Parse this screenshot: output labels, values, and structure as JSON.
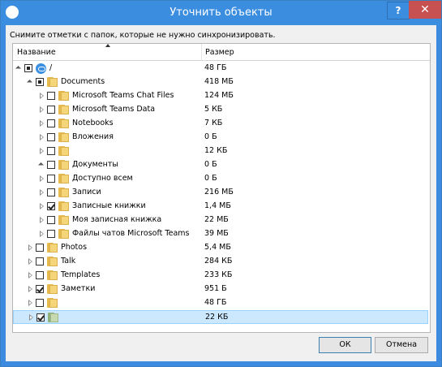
{
  "window": {
    "title": "Уточнить объекты",
    "help_label": "?",
    "close_label": "✕"
  },
  "instruction": "Снимите отметки с папок, которые не нужно синхронизировать.",
  "columns": {
    "name": "Название",
    "size": "Размер"
  },
  "rows": [
    {
      "name": "/",
      "size": "48 ГБ",
      "level": 0,
      "expander": "open",
      "check": "partial",
      "icon": "sync-icon"
    },
    {
      "name": "Documents",
      "size": "418 МБ",
      "level": 1,
      "expander": "open",
      "check": "partial",
      "icon": "folder-icon"
    },
    {
      "name": "Microsoft Teams Chat Files",
      "size": "124 МБ",
      "level": 2,
      "expander": "closed",
      "check": "unchecked",
      "icon": "folder-icon"
    },
    {
      "name": "Microsoft Teams Data",
      "size": "5 КБ",
      "level": 2,
      "expander": "closed",
      "check": "unchecked",
      "icon": "folder-icon"
    },
    {
      "name": "Notebooks",
      "size": "7 КБ",
      "level": 2,
      "expander": "closed",
      "check": "unchecked",
      "icon": "folder-icon"
    },
    {
      "name": "Вложения",
      "size": "0 Б",
      "level": 2,
      "expander": "closed",
      "check": "unchecked",
      "icon": "folder-icon"
    },
    {
      "name": "",
      "size": "12 КБ",
      "level": 2,
      "expander": "closed",
      "check": "unchecked",
      "icon": "folder-icon"
    },
    {
      "name": "Документы",
      "size": "0 Б",
      "level": 2,
      "expander": "open",
      "check": "unchecked",
      "icon": "folder-icon"
    },
    {
      "name": "Доступно всем",
      "size": "0 Б",
      "level": 2,
      "expander": "closed",
      "check": "unchecked",
      "icon": "folder-icon"
    },
    {
      "name": "Записи",
      "size": "216 МБ",
      "level": 2,
      "expander": "closed",
      "check": "unchecked",
      "icon": "folder-icon"
    },
    {
      "name": "Записные книжки",
      "size": "1,4 МБ",
      "level": 2,
      "expander": "closed",
      "check": "checked",
      "icon": "folder-icon"
    },
    {
      "name": "Моя записная книжка",
      "size": "22 МБ",
      "level": 2,
      "expander": "closed",
      "check": "unchecked",
      "icon": "folder-icon"
    },
    {
      "name": "Файлы чатов Microsoft Teams",
      "size": "39 МБ",
      "level": 2,
      "expander": "closed",
      "check": "unchecked",
      "icon": "folder-icon"
    },
    {
      "name": "Photos",
      "size": "5,4 МБ",
      "level": 1,
      "expander": "closed",
      "check": "unchecked",
      "icon": "folder-icon"
    },
    {
      "name": "Talk",
      "size": "284 КБ",
      "level": 1,
      "expander": "closed",
      "check": "unchecked",
      "icon": "folder-icon"
    },
    {
      "name": "Templates",
      "size": "233 КБ",
      "level": 1,
      "expander": "closed",
      "check": "unchecked",
      "icon": "folder-icon"
    },
    {
      "name": "Заметки",
      "size": "951 Б",
      "level": 1,
      "expander": "closed",
      "check": "checked",
      "icon": "folder-icon"
    },
    {
      "name": "",
      "size": "48 ГБ",
      "level": 1,
      "expander": "closed",
      "check": "unchecked",
      "icon": "folder-icon"
    },
    {
      "name": "",
      "size": "22 КБ",
      "level": 1,
      "expander": "closed",
      "check": "checked",
      "icon": "folder-icon",
      "selected": true
    }
  ],
  "buttons": {
    "ok": "ОК",
    "cancel": "Отмена"
  }
}
